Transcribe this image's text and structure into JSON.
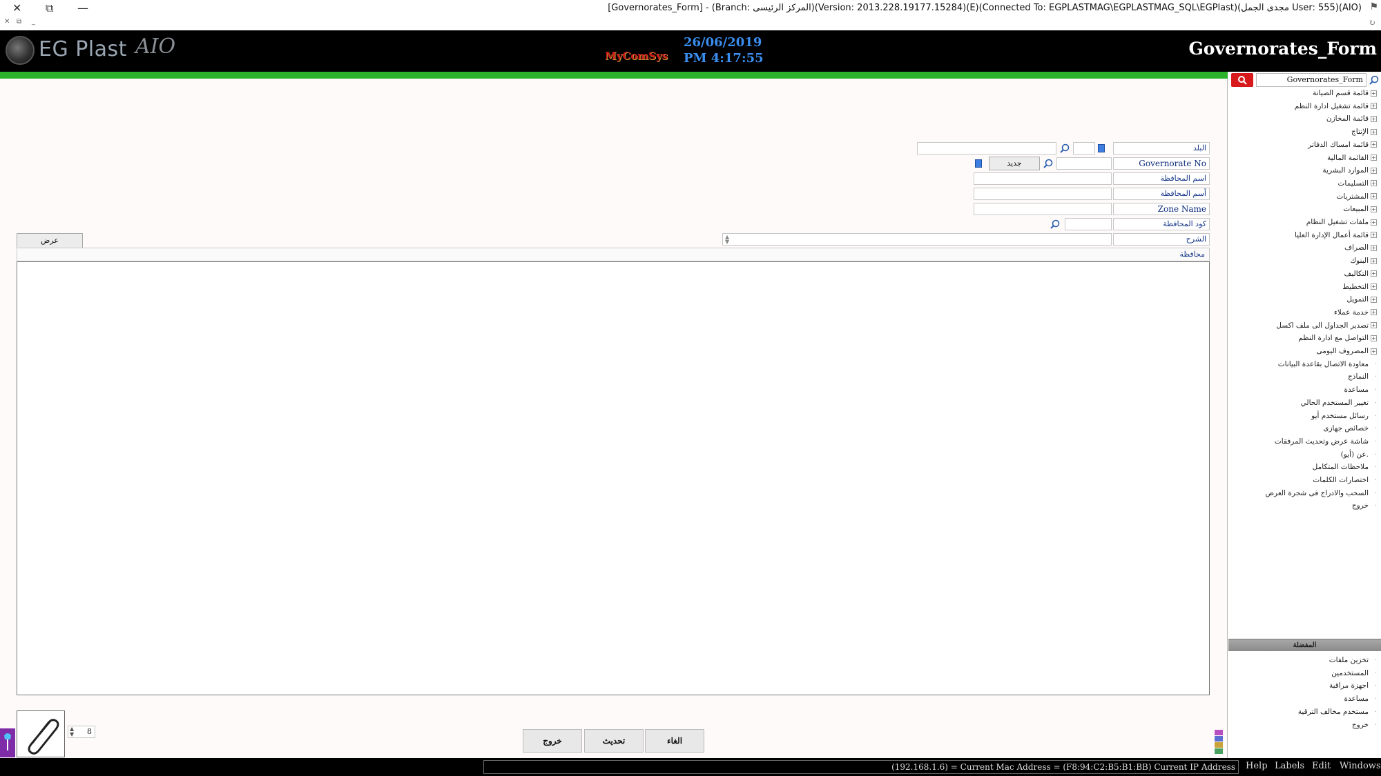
{
  "window": {
    "title": "[Governorates_Form] - (Branch: المركز الرئيسى)(Version: 2013.228.19177.15284)(E)(Connected To: EGPLASTMAG\\EGPLASTMAG_SQL\\EGPlast)(مجدى الجمل User: 555)(AIO)",
    "close_glyph": "✕",
    "restore_glyph": "⧉",
    "minimize_glyph": "—"
  },
  "header": {
    "logo_text": "EG Plast",
    "logo_suffix": "AIO",
    "brand_mark": "MyComSys",
    "date": "26/06/2019",
    "time": "PM 4:17:55",
    "form_title": "Governorates_Form"
  },
  "form": {
    "country_label": "البلد",
    "governorate_no_label": "Governorate No",
    "new_button": "جديد",
    "gov_name_label": "اسم المحافظة",
    "gov_name2_label": "أسم المحافظة",
    "zone_name_label": "Zone Name",
    "gov_code_label": "كود المحافظة",
    "description_label": "الشرح",
    "view_button": "عرض",
    "grid_header": "محافظة"
  },
  "actions": {
    "exit": "خروج",
    "update": "تحديث",
    "cancel": "الغاء"
  },
  "pager": {
    "value": "8"
  },
  "sidebar": {
    "search_value": "Governorates_Form",
    "items": [
      {
        "label": "قائمة قسم الصيانة",
        "expandable": true
      },
      {
        "label": "قائمة تشغيل ادارة النظم",
        "expandable": true
      },
      {
        "label": "قائمة المخازن",
        "expandable": true
      },
      {
        "label": "الإنتاج",
        "expandable": true
      },
      {
        "label": "قائمة امساك الدفاتر",
        "expandable": true
      },
      {
        "label": "القائمة المالية",
        "expandable": true
      },
      {
        "label": "الموارد البشرية",
        "expandable": true
      },
      {
        "label": "التسليمات",
        "expandable": true
      },
      {
        "label": "المشتريات",
        "expandable": true
      },
      {
        "label": "المبيعات",
        "expandable": true
      },
      {
        "label": "ملفات تشغيل النظام",
        "expandable": true
      },
      {
        "label": "قائمة أعمال الإدارة العليا",
        "expandable": true
      },
      {
        "label": "الصراف",
        "expandable": true
      },
      {
        "label": "البنوك",
        "expandable": true
      },
      {
        "label": "التكاليف",
        "expandable": true
      },
      {
        "label": "التخطيط",
        "expandable": true
      },
      {
        "label": "التمويل",
        "expandable": true
      },
      {
        "label": "خدمة عملاء",
        "expandable": true
      },
      {
        "label": "تصدير الجداول الى ملف اكسل",
        "expandable": true
      },
      {
        "label": "التواصل مع ادارة النظم",
        "expandable": true
      },
      {
        "label": "المصروف اليومى",
        "expandable": true
      },
      {
        "label": "معاودة الاتصال بقاعدة البيانات",
        "expandable": false
      },
      {
        "label": "النماذج",
        "expandable": false
      },
      {
        "label": "مساعدة",
        "expandable": false
      },
      {
        "label": "تغيير المستخدم الحالي",
        "expandable": false
      },
      {
        "label": "رسائل مستخدم أيو",
        "expandable": false
      },
      {
        "label": "خصائص جهازى",
        "expandable": false
      },
      {
        "label": "شاشة عرض وتحديث المرفقات",
        "expandable": false
      },
      {
        "label": "عن (أيو).",
        "expandable": false
      },
      {
        "label": "ملاحظات المتكامل",
        "expandable": false
      },
      {
        "label": "اختصارات الكلمات",
        "expandable": false
      },
      {
        "label": "السحب والادراج فى شجرة العرض",
        "expandable": false
      },
      {
        "label": "خروج",
        "expandable": false
      }
    ],
    "favorites_header": "المفضلة",
    "favorites": [
      {
        "label": "تخزين ملفات"
      },
      {
        "label": "المستخدمين"
      },
      {
        "label": "اجهزة مراقبة"
      },
      {
        "label": "مساعدة"
      },
      {
        "label": "مستخدم مخالف الترقية"
      },
      {
        "label": "خروج"
      }
    ]
  },
  "statusbar": {
    "ip_info": "(192.168.1.6) = Current Mac Address = (F8:94:C2:B5:B1:BB) Current IP Address",
    "menu": [
      "Help",
      "Labels",
      "Edit",
      "Windows"
    ]
  },
  "colors": {
    "accent_green": "#2bb32b",
    "header_bg": "#000000",
    "date_blue": "#3a8ef0",
    "search_red": "#d7191c",
    "label_blue": "#1a3a8c"
  }
}
